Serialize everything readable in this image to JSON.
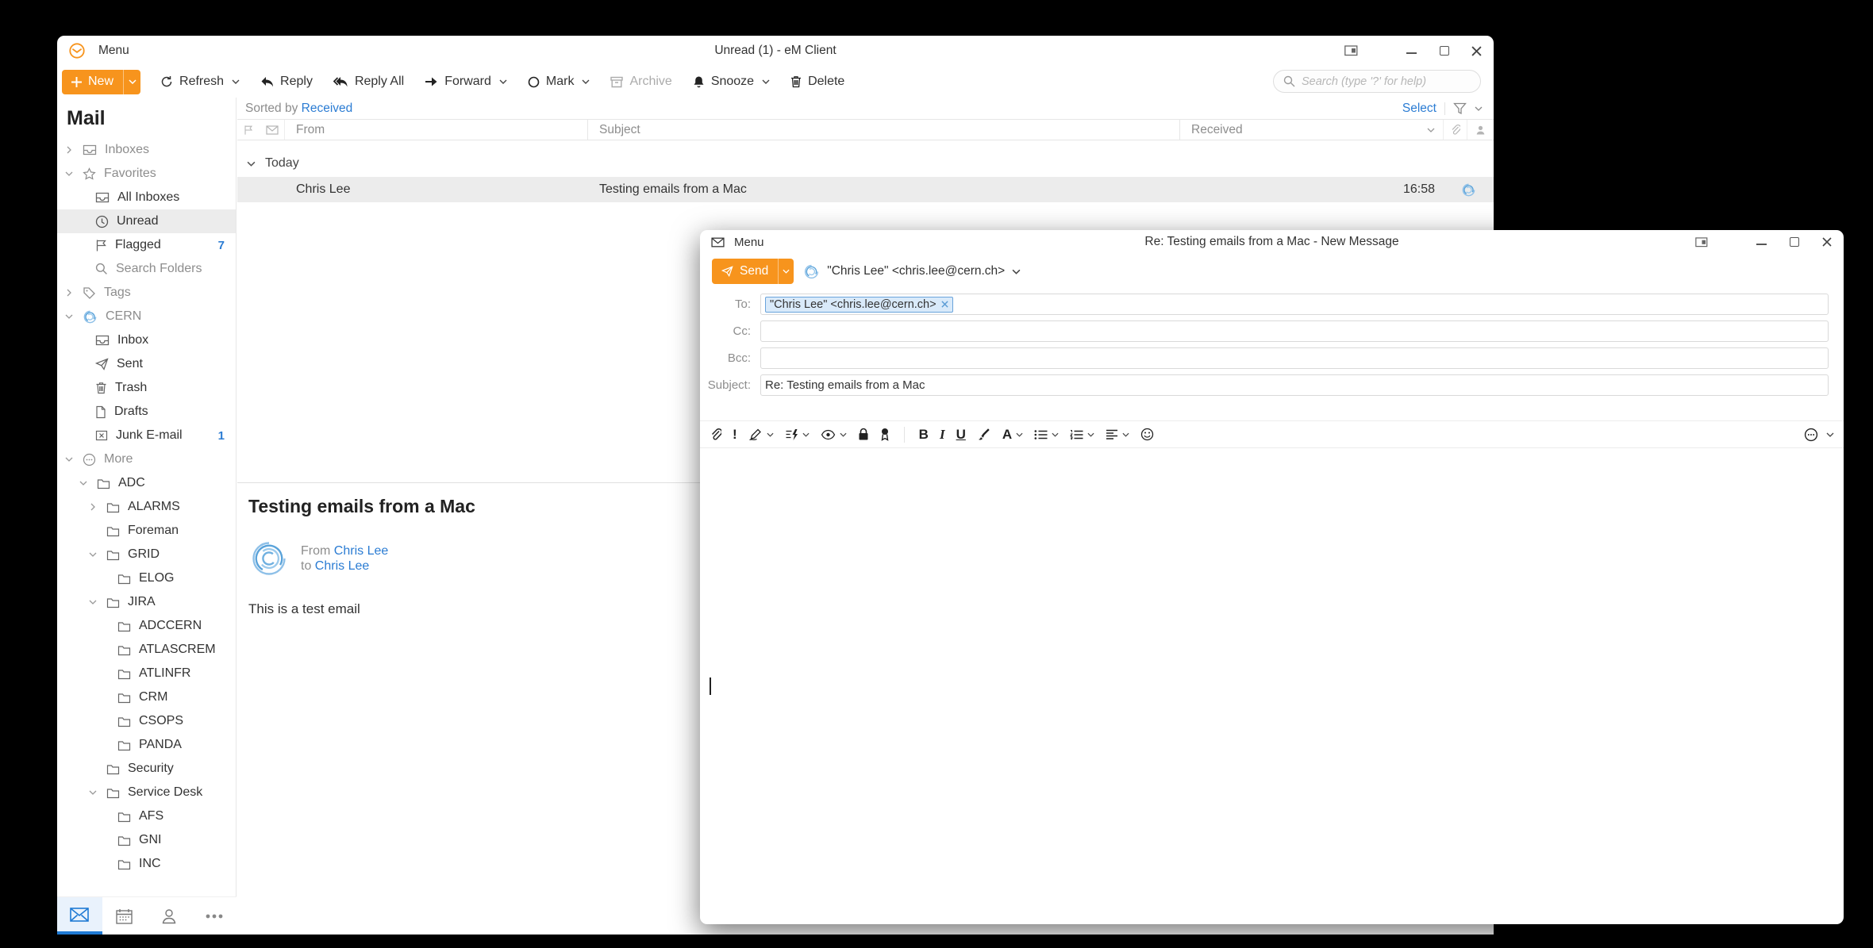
{
  "colors": {
    "accent_orange": "#F7941D",
    "link_blue": "#2B7CD3",
    "selected_row_bg": "#ececec",
    "chip_bg": "#D9EAFA",
    "chip_border": "#69A3DB",
    "active_nav_bg": "#E9F2FC"
  },
  "main_window": {
    "menu_label": "Menu",
    "title": "Unread (1) - eM Client",
    "toolbar": {
      "new": "New",
      "refresh": "Refresh",
      "reply": "Reply",
      "reply_all": "Reply All",
      "forward": "Forward",
      "mark": "Mark",
      "archive": "Archive",
      "snooze": "Snooze",
      "delete": "Delete"
    },
    "search_placeholder": "Search (type '?' for help)"
  },
  "sidebar": {
    "title": "Mail",
    "items": [
      {
        "label": "Inboxes"
      },
      {
        "label": "Favorites"
      },
      {
        "label": "All Inboxes"
      },
      {
        "label": "Unread"
      },
      {
        "label": "Flagged",
        "badge": "7"
      },
      {
        "label": "Search Folders"
      },
      {
        "label": "Tags"
      },
      {
        "label": "CERN"
      },
      {
        "label": "Inbox"
      },
      {
        "label": "Sent"
      },
      {
        "label": "Trash"
      },
      {
        "label": "Drafts"
      },
      {
        "label": "Junk E-mail",
        "badge": "1"
      },
      {
        "label": "More"
      },
      {
        "label": "ADC"
      },
      {
        "label": "ALARMS"
      },
      {
        "label": "Foreman"
      },
      {
        "label": "GRID"
      },
      {
        "label": "ELOG"
      },
      {
        "label": "JIRA"
      },
      {
        "label": "ADCCERN"
      },
      {
        "label": "ATLASCREM"
      },
      {
        "label": "ATLINFR"
      },
      {
        "label": "CRM"
      },
      {
        "label": "CSOPS"
      },
      {
        "label": "PANDA"
      },
      {
        "label": "Security"
      },
      {
        "label": "Service Desk"
      },
      {
        "label": "AFS"
      },
      {
        "label": "GNI"
      },
      {
        "label": "INC"
      }
    ]
  },
  "list": {
    "sorted_by_label": "Sorted by",
    "sorted_by_value": "Received",
    "select_label": "Select",
    "columns": {
      "from": "From",
      "subject": "Subject",
      "received": "Received"
    },
    "group_label": "Today",
    "rows": [
      {
        "from": "Chris Lee",
        "subject": "Testing emails from a Mac",
        "received": "16:58"
      }
    ]
  },
  "reading_pane": {
    "subject": "Testing emails from a Mac",
    "from_label": "From",
    "from_name": "Chris Lee",
    "to_label": "to",
    "to_name": "Chris Lee",
    "body": "This is a test email"
  },
  "compose": {
    "menu_label": "Menu",
    "title": "Re: Testing emails from a Mac - New Message",
    "send_label": "Send",
    "from_account": "\"Chris Lee\" <chris.lee@cern.ch>",
    "fields": {
      "to_label": "To:",
      "cc_label": "Cc:",
      "bcc_label": "Bcc:",
      "subject_label": "Subject:",
      "to_chip": "\"Chris Lee\" <chris.lee@cern.ch>",
      "subject_value": "Re: Testing emails from a Mac"
    }
  }
}
